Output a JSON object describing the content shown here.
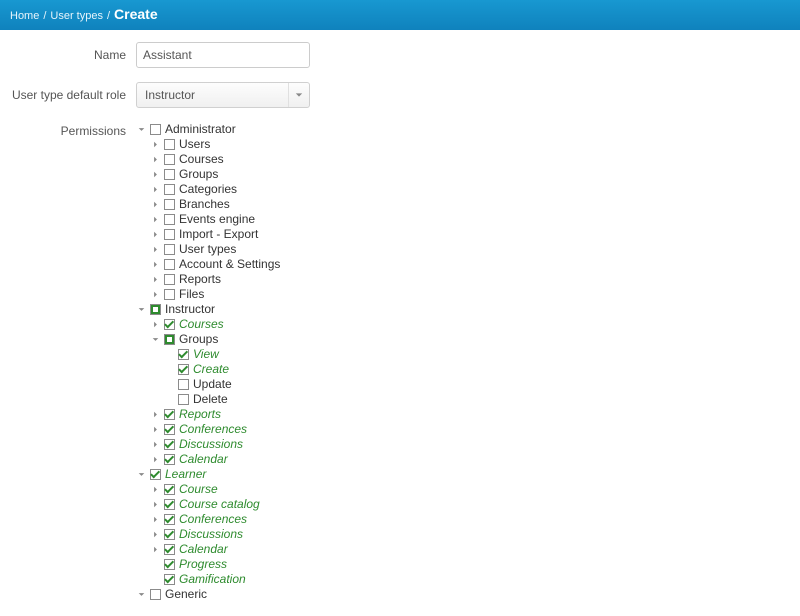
{
  "breadcrumb": {
    "home": "Home",
    "user_types": "User types",
    "current": "Create"
  },
  "form": {
    "name_label": "Name",
    "name_value": "Assistant",
    "role_label": "User type default role",
    "role_value": "Instructor",
    "permissions_label": "Permissions"
  },
  "tree": [
    {
      "label": "Administrator",
      "state": "empty",
      "green": false,
      "toggle": "open",
      "children": [
        {
          "label": "Users",
          "state": "empty",
          "green": false,
          "toggle": "closed"
        },
        {
          "label": "Courses",
          "state": "empty",
          "green": false,
          "toggle": "closed"
        },
        {
          "label": "Groups",
          "state": "empty",
          "green": false,
          "toggle": "closed"
        },
        {
          "label": "Categories",
          "state": "empty",
          "green": false,
          "toggle": "closed"
        },
        {
          "label": "Branches",
          "state": "empty",
          "green": false,
          "toggle": "closed"
        },
        {
          "label": "Events engine",
          "state": "empty",
          "green": false,
          "toggle": "closed"
        },
        {
          "label": "Import - Export",
          "state": "empty",
          "green": false,
          "toggle": "closed"
        },
        {
          "label": "User types",
          "state": "empty",
          "green": false,
          "toggle": "closed"
        },
        {
          "label": "Account & Settings",
          "state": "empty",
          "green": false,
          "toggle": "closed"
        },
        {
          "label": "Reports",
          "state": "empty",
          "green": false,
          "toggle": "closed"
        },
        {
          "label": "Files",
          "state": "empty",
          "green": false,
          "toggle": "closed"
        }
      ]
    },
    {
      "label": "Instructor",
      "state": "partial",
      "green": false,
      "toggle": "open",
      "children": [
        {
          "label": "Courses",
          "state": "checked",
          "green": true,
          "toggle": "closed"
        },
        {
          "label": "Groups",
          "state": "partial",
          "green": false,
          "toggle": "open",
          "children": [
            {
              "label": "View",
              "state": "checked",
              "green": true,
              "toggle": "none"
            },
            {
              "label": "Create",
              "state": "checked",
              "green": true,
              "toggle": "none"
            },
            {
              "label": "Update",
              "state": "empty",
              "green": false,
              "toggle": "none"
            },
            {
              "label": "Delete",
              "state": "empty",
              "green": false,
              "toggle": "none"
            }
          ]
        },
        {
          "label": "Reports",
          "state": "checked",
          "green": true,
          "toggle": "closed"
        },
        {
          "label": "Conferences",
          "state": "checked",
          "green": true,
          "toggle": "closed"
        },
        {
          "label": "Discussions",
          "state": "checked",
          "green": true,
          "toggle": "closed"
        },
        {
          "label": "Calendar",
          "state": "checked",
          "green": true,
          "toggle": "closed"
        }
      ]
    },
    {
      "label": "Learner",
      "state": "checked",
      "green": true,
      "toggle": "open",
      "children": [
        {
          "label": "Course",
          "state": "checked",
          "green": true,
          "toggle": "closed"
        },
        {
          "label": "Course catalog",
          "state": "checked",
          "green": true,
          "toggle": "closed"
        },
        {
          "label": "Conferences",
          "state": "checked",
          "green": true,
          "toggle": "closed"
        },
        {
          "label": "Discussions",
          "state": "checked",
          "green": true,
          "toggle": "closed"
        },
        {
          "label": "Calendar",
          "state": "checked",
          "green": true,
          "toggle": "closed"
        },
        {
          "label": "Progress",
          "state": "checked",
          "green": true,
          "toggle": "none"
        },
        {
          "label": "Gamification",
          "state": "checked",
          "green": true,
          "toggle": "none"
        }
      ]
    },
    {
      "label": "Generic",
      "state": "empty",
      "green": false,
      "toggle": "open",
      "children": []
    }
  ]
}
